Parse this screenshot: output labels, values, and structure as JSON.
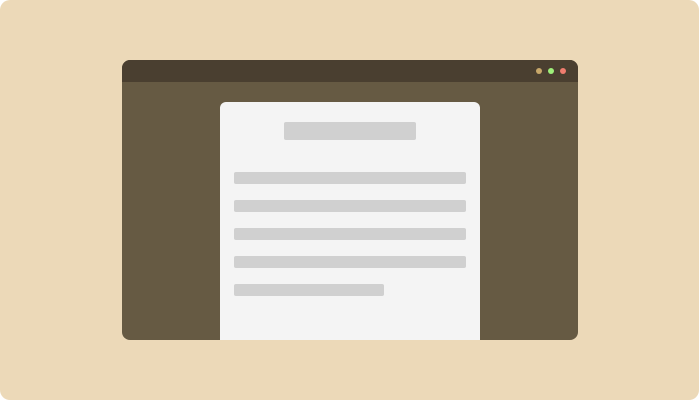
{
  "colors": {
    "background": "#ecd9b8",
    "window_body": "#665a43",
    "titlebar": "#4a3f30",
    "document": "#f4f4f4",
    "placeholder": "#d0d0d0",
    "dot_minimize": "#c8a86a",
    "dot_maximize": "#9ef07a",
    "dot_close": "#f07d6f"
  },
  "window": {
    "controls": [
      "minimize-icon",
      "maximize-icon",
      "close-icon"
    ]
  },
  "document": {
    "title_placeholder": "text-placeholder",
    "line_placeholders": [
      "text-placeholder",
      "text-placeholder",
      "text-placeholder",
      "text-placeholder",
      "text-placeholder"
    ]
  }
}
